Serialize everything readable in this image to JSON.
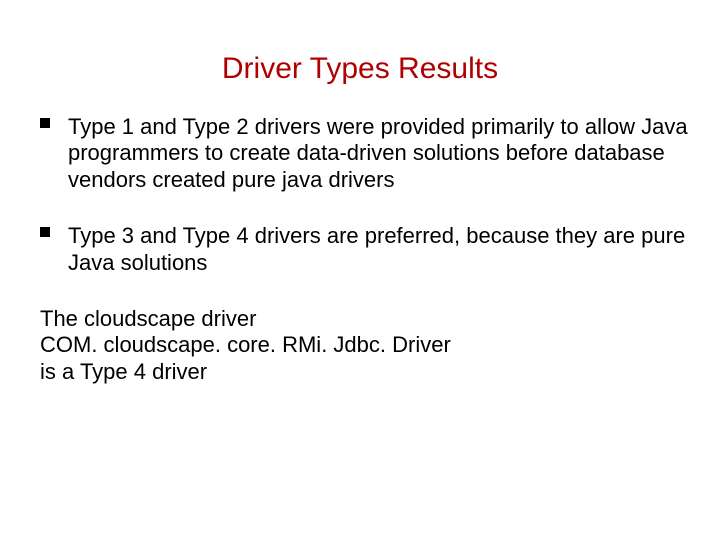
{
  "title": "Driver Types Results",
  "bullets": {
    "items": [
      "Type 1 and  Type 2 drivers were provided primarily to allow Java programmers to create data-driven solutions before database vendors created pure java drivers",
      "Type 3 and Type 4 drivers are preferred, because they are pure Java solutions"
    ]
  },
  "footer": {
    "line1": "The cloudscape driver",
    "line2": "COM. cloudscape. core. RMi. Jdbc. Driver",
    "line3": "is a Type 4 driver"
  }
}
